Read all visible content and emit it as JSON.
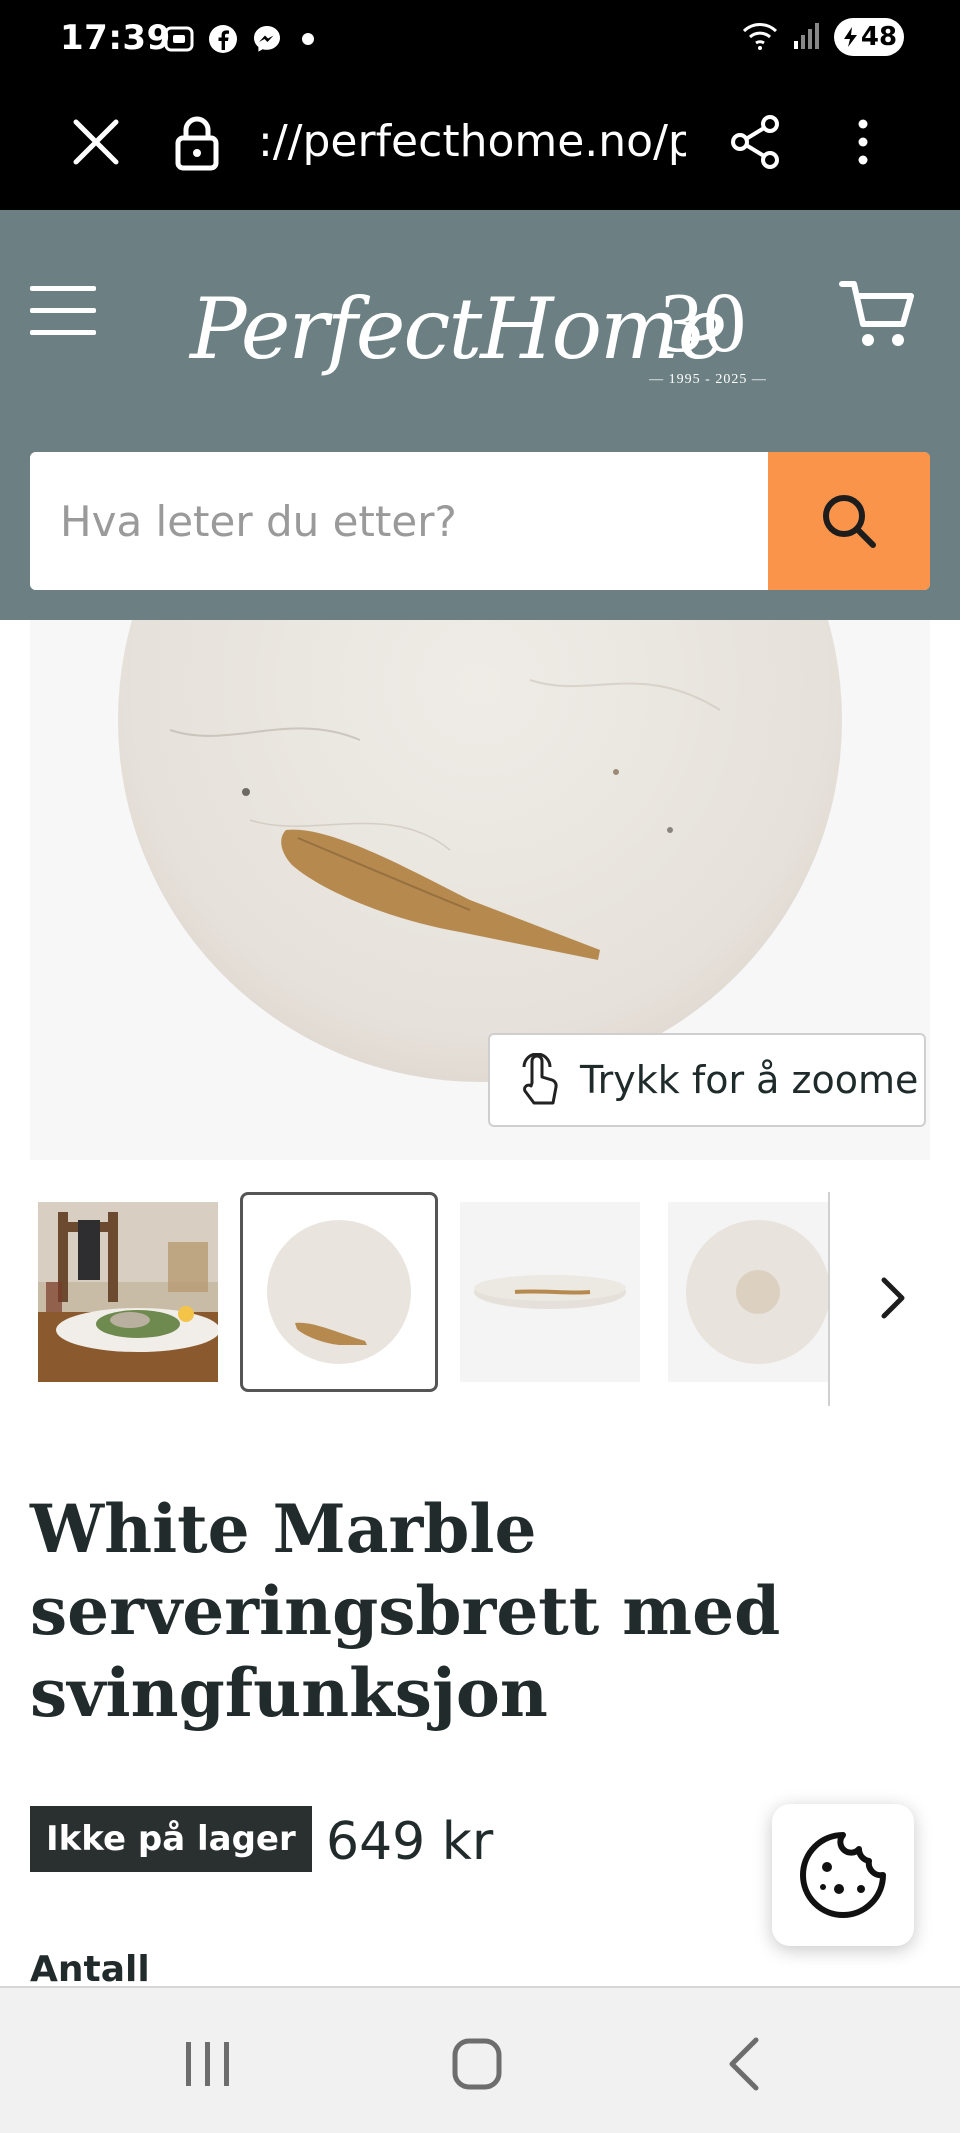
{
  "status_bar": {
    "time": "17:39",
    "battery": "48",
    "icons": [
      "screenshot-icon",
      "facebook-icon",
      "messenger-icon",
      "notification-dot",
      "wifi-icon",
      "signal-icon",
      "battery-icon"
    ]
  },
  "browser": {
    "url": "://perfecthome.no/p",
    "icons": [
      "close-icon",
      "lock-icon",
      "share-icon",
      "more-vert-icon"
    ]
  },
  "site_header": {
    "background": "#6c8083",
    "logo_text": "PerfectHome",
    "logo_anniversary": "30",
    "logo_years": "— 1995 - 2025 —",
    "icons": [
      "menu-icon",
      "cart-icon"
    ]
  },
  "search": {
    "placeholder": "Hva leter du etter?",
    "button_color": "#f9944a",
    "icon": "search-icon"
  },
  "product_image": {
    "zoom_hint": "Trykk for å zoome",
    "zoom_icon": "tap-finger-icon"
  },
  "thumbnails": {
    "selected_index": 1,
    "count_visible": 4,
    "items": [
      "lifestyle-table-photo",
      "marble-board-top",
      "marble-board-side",
      "marble-board-bottom"
    ],
    "next_icon": "chevron-right-icon"
  },
  "product": {
    "title": "White Marble serveringsbrett med svingfunksjon",
    "stock_status": "Ikke på lager",
    "price": "649 kr",
    "quantity_label": "Antall",
    "cookie_icon": "cookie-icon"
  },
  "android_nav": {
    "icons": [
      "recents-icon",
      "home-icon",
      "back-icon"
    ]
  }
}
